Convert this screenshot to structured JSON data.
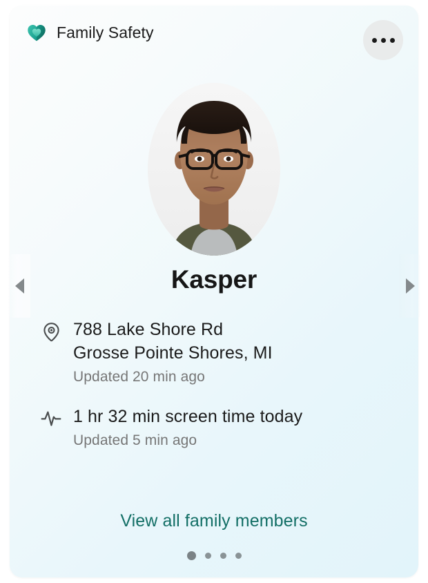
{
  "header": {
    "app_title": "Family Safety",
    "brand_icon": "family-safety-heart-icon",
    "brand_color_light": "#2bb3a3",
    "brand_color_dark": "#0d6b5e",
    "more_button_label": "More options",
    "more_icon": "ellipsis-icon"
  },
  "member": {
    "name": "Kasper",
    "avatar_alt": "Kasper profile photo"
  },
  "details": [
    {
      "icon": "location-pin-icon",
      "primary_line_1": "788 Lake Shore Rd",
      "primary_line_2": "Grosse Pointe Shores, MI",
      "sub": "Updated 20 min ago"
    },
    {
      "icon": "pulse-activity-icon",
      "primary_line_1": "1 hr 32 min screen time today",
      "sub": "Updated 5 min ago"
    }
  ],
  "footer": {
    "view_all_label": "View all family members",
    "link_color": "#136f66"
  },
  "carousel": {
    "prev_label": "Previous family member",
    "next_label": "Next family member",
    "prev_icon": "chevron-left-icon",
    "next_icon": "chevron-right-icon",
    "page_count": 4,
    "active_page": 1
  }
}
